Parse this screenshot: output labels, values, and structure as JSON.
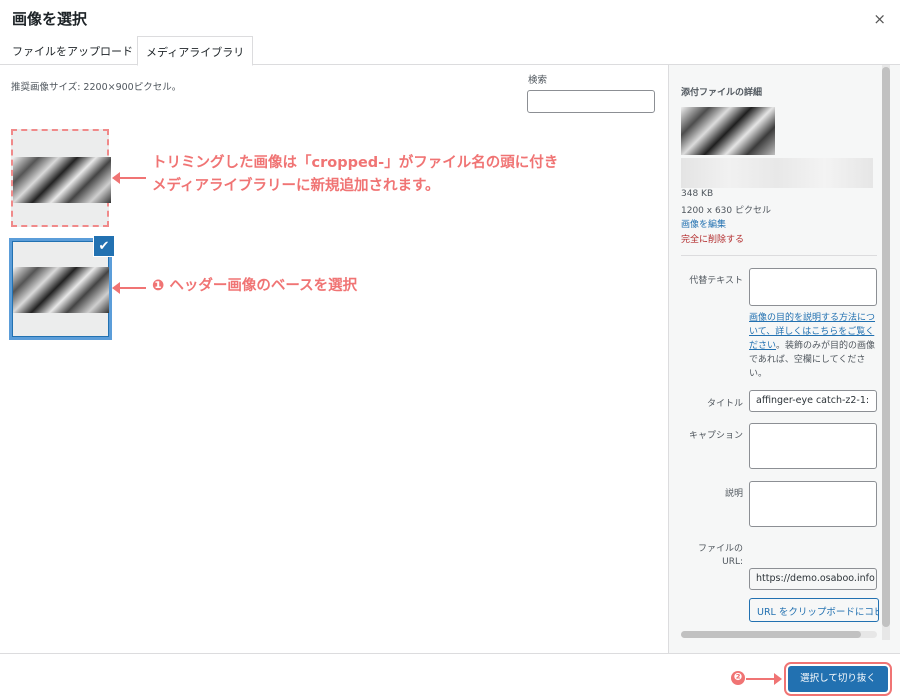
{
  "header": {
    "title": "画像を選択",
    "close_glyph": "×"
  },
  "tabs": [
    {
      "label": "ファイルをアップロード"
    },
    {
      "label": "メディアライブラリ"
    }
  ],
  "library": {
    "size_note": "推奨画像サイズ: 2200×900ピクセル。",
    "search_label": "検索",
    "search_value": ""
  },
  "annotations": {
    "line1": "トリミングした画像は「cropped-」がファイル名の頭に付き",
    "line2": "メディアライブラリーに新規追加されます。",
    "step1": "❶ ヘッダー画像のベースを選択",
    "step2": "❷"
  },
  "details": {
    "title": "添付ファイルの詳細",
    "file_size": "348 KB",
    "dimensions": "1200 x 630 ピクセル",
    "edit_link": "画像を編集",
    "delete_link": "完全に削除する",
    "alt_label": "代替テキスト",
    "alt_value": "",
    "alt_help_link": "画像の目的を説明する方法について、詳しくはこちらをご覧ください",
    "alt_help_text": "。装飾のみが目的の画像であれば、空欄にしてください。",
    "title_label": "タイトル",
    "title_value": "affinger-eye catch-z2-1:",
    "caption_label": "キャプション",
    "caption_value": "",
    "description_label": "説明",
    "description_value": "",
    "url_label": "ファイルのURL:",
    "url_value": "https://demo.osaboo.info",
    "copy_button": "URL をクリップボードにコピ"
  },
  "footer": {
    "select_button": "選択して切り抜く"
  }
}
